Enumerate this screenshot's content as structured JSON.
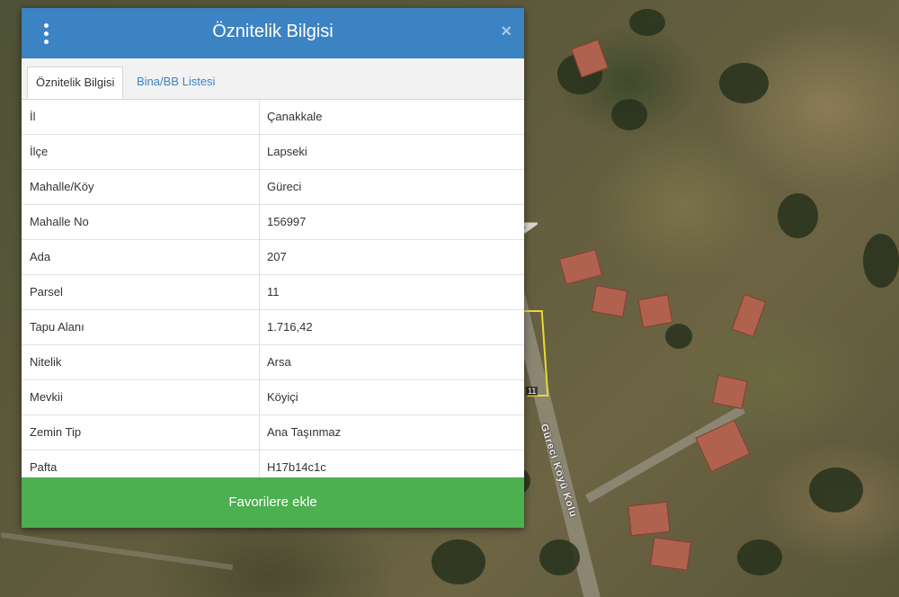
{
  "panel": {
    "title": "Öznitelik Bilgisi",
    "close_symbol": "×",
    "menu_icon": "vertical-dots-icon",
    "tabs": [
      {
        "label": "Öznitelik Bilgisi",
        "active": true
      },
      {
        "label": "Bina/BB Listesi",
        "active": false
      }
    ],
    "rows": [
      {
        "key": "İl",
        "value": "Çanakkale"
      },
      {
        "key": "İlçe",
        "value": "Lapseki"
      },
      {
        "key": "Mahalle/Köy",
        "value": "Güreci"
      },
      {
        "key": "Mahalle No",
        "value": "156997"
      },
      {
        "key": "Ada",
        "value": "207"
      },
      {
        "key": "Parsel",
        "value": "11"
      },
      {
        "key": "Tapu Alanı",
        "value": "1.716,42"
      },
      {
        "key": "Nitelik",
        "value": "Arsa"
      },
      {
        "key": "Mevkii",
        "value": "Köyiçi"
      },
      {
        "key": "Zemin Tip",
        "value": "Ana Taşınmaz"
      },
      {
        "key": "Pafta",
        "value": "H17b14c1c"
      }
    ],
    "favorite_button": "Favorilere ekle"
  },
  "map": {
    "parcel_label": "11",
    "road_label": "Güreci Köyü Kolu"
  },
  "colors": {
    "header": "#3c83c4",
    "favorite": "#4caf50",
    "parcel_outline": "#e8d93a"
  }
}
